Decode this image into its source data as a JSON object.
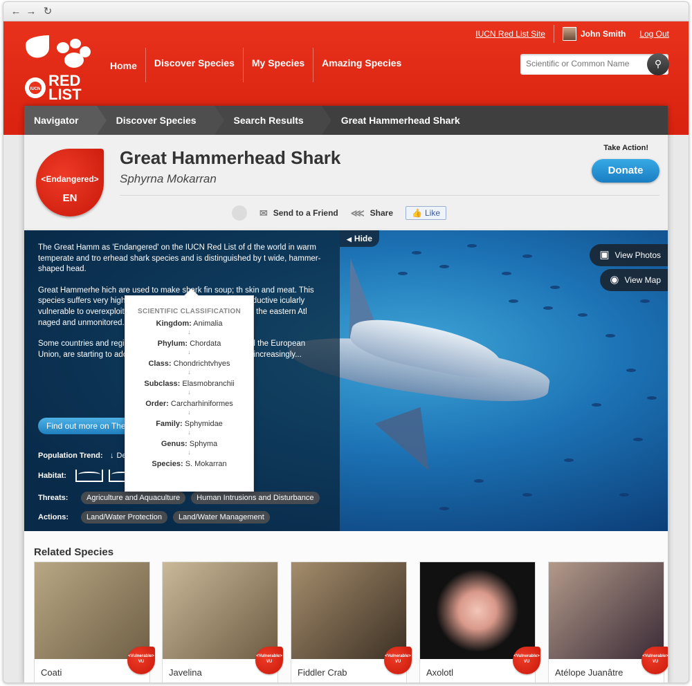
{
  "browser": {
    "back_icon": "arrow-left-icon",
    "forward_icon": "arrow-right-icon",
    "reload_icon": "reload-icon"
  },
  "header": {
    "site_link": "IUCN Red List Site",
    "user_name": "John Smith",
    "logout": "Log Out",
    "logo_text_1": "RED",
    "logo_text_2": "LIST",
    "logo_small": "IUCN",
    "nav": [
      "Home",
      "Discover Species",
      "My Species",
      "Amazing Species"
    ],
    "search_placeholder": "Scientific or Common Name"
  },
  "breadcrumb": [
    "Navigator",
    "Discover Species",
    "Search Results",
    "Great Hammerhead Shark"
  ],
  "species": {
    "status_label": "<Endangered>",
    "status_code": "EN",
    "common_name": "Great Hammerhead Shark",
    "scientific_name": "Sphyrna Mokarran",
    "take_action": "Take Action!",
    "donate": "Donate",
    "actions": {
      "send": "Send to a Friend",
      "share": "Share",
      "like": "Like"
    }
  },
  "classification": {
    "title": "SCIENTIFIC CLASSIFICATION",
    "rows": [
      {
        "k": "Kingdom:",
        "v": "Animalia"
      },
      {
        "k": "Phylum:",
        "v": "Chordata"
      },
      {
        "k": "Class:",
        "v": "Chondrichtvhyes"
      },
      {
        "k": "Subclass:",
        "v": "Elasmobranchii"
      },
      {
        "k": "Order:",
        "v": "Carcharhiniformes"
      },
      {
        "k": "Family:",
        "v": "Sphymidae"
      },
      {
        "k": "Genus:",
        "v": "Sphyma"
      },
      {
        "k": "Species:",
        "v": "S. Mokarran"
      }
    ]
  },
  "hero": {
    "hide": "Hide",
    "view_photos": "View Photos",
    "view_map": "View Map",
    "paragraphs": [
      "The Great Hamm                                   as 'Endangered' on the IUCN Red List of                                   d the world in warm temperate and tro                                 erhead shark species and is distinguished by t                               wide, hammer-shaped head.",
      "Great Hammerhe                               hich are used to make shark fin soup; th                              skin and meat. This species suffers very high l                              fisheries, and due to its slow reproductive                             icularly vulnerable to overexploitation. A                             eclines, especially in parts of the eastern Atl                          naged and unmonitored.",
      "Some countries and regions, including the USA, Australia and the European Union, are starting to adopt shark finning bans, which should increasingly..."
    ],
    "find_more": "Find out more on The IUCN Red List",
    "population_label": "Population Trend:",
    "population_value": "Decreasing",
    "habitat_label": "Habitat:",
    "threats_label": "Threats:",
    "threats": [
      "Agriculture and Aquaculture",
      "Human Intrusions and Disturbance"
    ],
    "actions_label": "Actions:",
    "actions": [
      "Land/Water Protection",
      "Land/Water Management"
    ]
  },
  "related": {
    "title": "Related Species",
    "badge_label": "<Vulnerable>",
    "badge_code": "VU",
    "items": [
      {
        "name": "Coati",
        "color": "#8a7a5c"
      },
      {
        "name": "Javelina",
        "color": "#7d6b4e"
      },
      {
        "name": "Fiddler Crab",
        "color": "#6a5640"
      },
      {
        "name": "Axolotl",
        "color": "#1a1a1a"
      },
      {
        "name": "Atélope Juanâtre",
        "color": "#5b4b4e"
      }
    ]
  },
  "colors": {
    "brand_red": "#e8321c",
    "donate_blue": "#1a7ec2"
  }
}
